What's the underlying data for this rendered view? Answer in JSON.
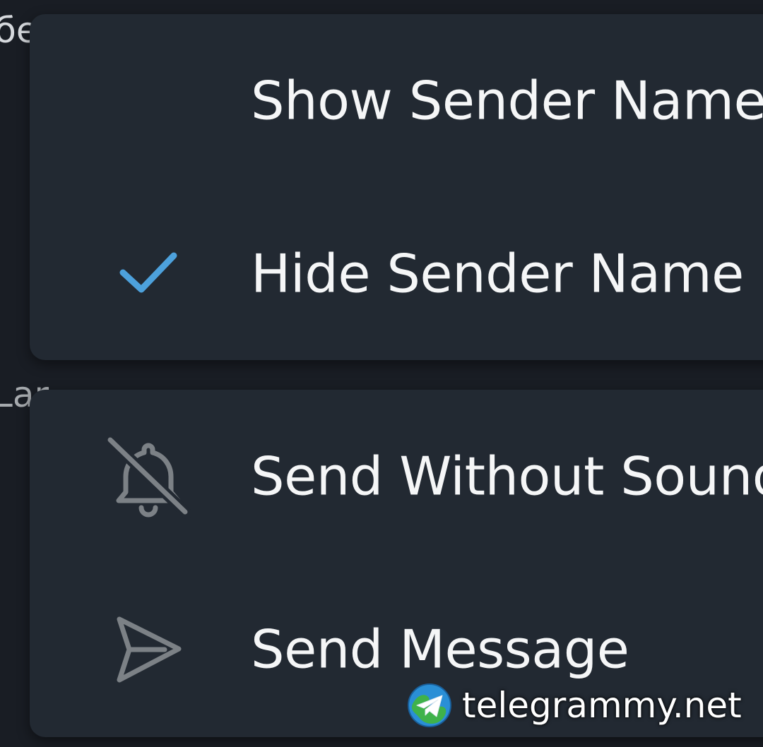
{
  "background": {
    "top_fragment": "бе",
    "mid_fragment": "Lar"
  },
  "menus": {
    "sender_options": {
      "items": [
        {
          "label": "Show Sender Name",
          "selected": false
        },
        {
          "label": "Hide Sender Name",
          "selected": true
        }
      ]
    },
    "send_options": {
      "items": [
        {
          "label": "Send Without Sound",
          "icon": "bell-off-icon"
        },
        {
          "label": "Send Message",
          "icon": "send-icon"
        }
      ]
    }
  },
  "watermark": {
    "text": "telegrammy.net"
  },
  "colors": {
    "background": "#191d24",
    "menu_surface": "#222932",
    "check_accent": "#4da1dc",
    "icon_gray": "#7c8186",
    "text": "#f5f6f7"
  }
}
